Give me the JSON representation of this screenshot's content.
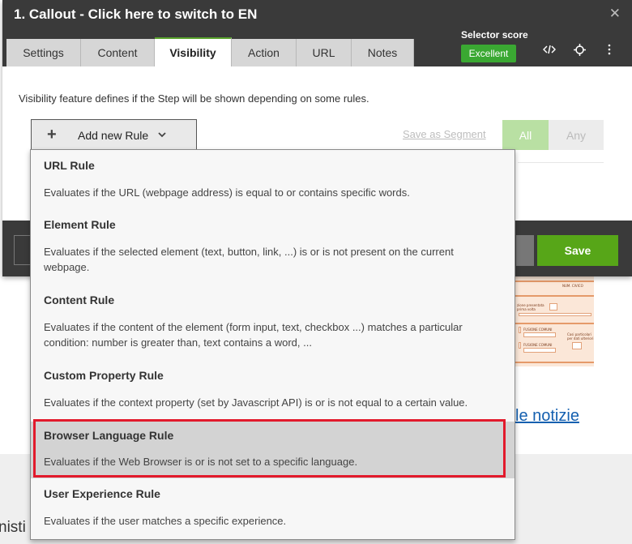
{
  "header": {
    "title": "1. Callout - Click here to switch to EN",
    "close_icon": "close-icon",
    "tabs": [
      {
        "label": "Settings"
      },
      {
        "label": "Content"
      },
      {
        "label": "Visibility"
      },
      {
        "label": "Action"
      },
      {
        "label": "URL"
      },
      {
        "label": "Notes"
      }
    ],
    "active_tab": "Visibility",
    "selector_score_label": "Selector score",
    "selector_score_value": "Excellent",
    "icons": [
      "code-icon",
      "target-icon",
      "more-vertical-icon"
    ]
  },
  "visibility": {
    "description": "Visibility feature defines if the Step will be shown depending on some rules.",
    "add_rule_label": "Add new Rule",
    "save_segment_label": "Save as Segment",
    "toggle_all": "All",
    "toggle_any": "Any"
  },
  "footer": {
    "save_label": "Save"
  },
  "dropdown": {
    "rules": [
      {
        "title": "URL Rule",
        "desc": "Evaluates if the URL (webpage address) is equal to or contains specific words."
      },
      {
        "title": "Element Rule",
        "desc": "Evaluates if the selected element (text, button, link, ...) is or is not present on the current webpage."
      },
      {
        "title": "Content Rule",
        "desc": "Evaluates if the content of the element (form input, text, checkbox ...) matches a particular condition: number is greater than, text contains a word, ..."
      },
      {
        "title": "Custom Property Rule",
        "desc": "Evaluates if the context property (set by Javascript API) is or is not equal to a certain value."
      },
      {
        "title": "Browser Language Rule",
        "desc": "Evaluates if the Web Browser is or is not set to a specific language."
      },
      {
        "title": "User Experience Rule",
        "desc": "Evaluates if the user matches a specific experience."
      }
    ],
    "highlighted_rule": "Browser Language Rule"
  },
  "background": {
    "link_text": "le notizie",
    "footer_text": "nisti",
    "doc_labels": [
      "NUM. CIVICO",
      "zione presentata",
      "prima volta",
      "FUSIONE COMUNI",
      "FUSIONE COMUNI",
      "Casi particolari",
      "per dati ulteriori"
    ]
  },
  "colors": {
    "header_bg": "#3a3a3a",
    "accent_green": "#57a618",
    "score_green": "#3aa832",
    "highlight_red": "#e21a2c",
    "link_blue": "#1560b0"
  }
}
